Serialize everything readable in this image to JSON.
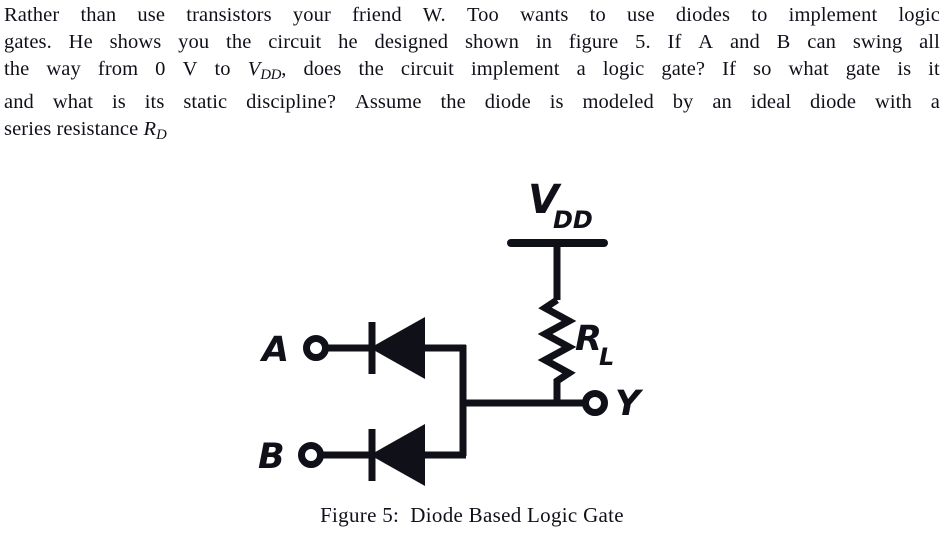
{
  "document": {
    "problem": {
      "lines": [
        [
          "Rather",
          "than",
          "use",
          "transistors",
          "your",
          "friend",
          "W.",
          "Too",
          "wants",
          "to",
          "use",
          "diodes",
          "to",
          "implement",
          "logic"
        ],
        [
          "gates.",
          "He",
          "shows",
          "you",
          "the",
          "circuit",
          "he",
          "designed",
          "shown",
          "in",
          "figure",
          "5.",
          "If",
          "A",
          "and",
          "B",
          "can",
          "swing",
          "all"
        ],
        [
          "the",
          "way",
          "from",
          "0",
          "V",
          "to",
          "@VDD@,",
          "does",
          "the",
          "circuit",
          "implement",
          "a",
          "logic",
          "gate?",
          "If",
          "so",
          "what",
          "gate",
          "is",
          "it"
        ],
        [
          "and",
          "what",
          "is",
          "its",
          "static",
          "discipline?",
          "Assume",
          "the",
          "diode",
          "is",
          "modeled",
          "by",
          "an",
          "ideal",
          "diode",
          "with",
          "a"
        ],
        [
          "series",
          "resistance",
          "@RD@"
        ]
      ],
      "inline_math": {
        "VDD": {
          "base": "V",
          "sub": "DD"
        },
        "RD": {
          "base": "R",
          "sub": "D"
        }
      },
      "plain_text": "Rather than use transistors your friend W. Too wants to use diodes to implement logic gates. He shows you the circuit he designed shown in figure 5. If A and B can swing all the way from 0 V to VDD, does the circuit implement a logic gate? If so what gate is it and what is its static discipline? Assume the diode is modeled by an ideal diode with a series resistance RD"
    },
    "figure": {
      "caption": "Figure 5:  Diode Based Logic Gate",
      "caption_label": "Figure 5:",
      "caption_title": "Diode Based Logic Gate",
      "ink_color": "#101018",
      "background_color": "#ffffff",
      "labels": {
        "input_a": "A",
        "input_b": "B",
        "output_y": "Y",
        "supply_base": "V",
        "supply_sub": "DD",
        "resistor_base": "R",
        "resistor_sub": "L"
      },
      "components": [
        {
          "name": "diode-a",
          "type": "diode",
          "orientation": "cathode-left"
        },
        {
          "name": "diode-b",
          "type": "diode",
          "orientation": "cathode-left"
        },
        {
          "name": "load-resistor",
          "type": "resistor",
          "label": "RL"
        },
        {
          "name": "supply-rail",
          "type": "rail",
          "label": "VDD"
        },
        {
          "name": "terminal-a",
          "type": "terminal",
          "label": "A"
        },
        {
          "name": "terminal-b",
          "type": "terminal",
          "label": "B"
        },
        {
          "name": "terminal-y",
          "type": "terminal",
          "label": "Y"
        }
      ]
    }
  }
}
